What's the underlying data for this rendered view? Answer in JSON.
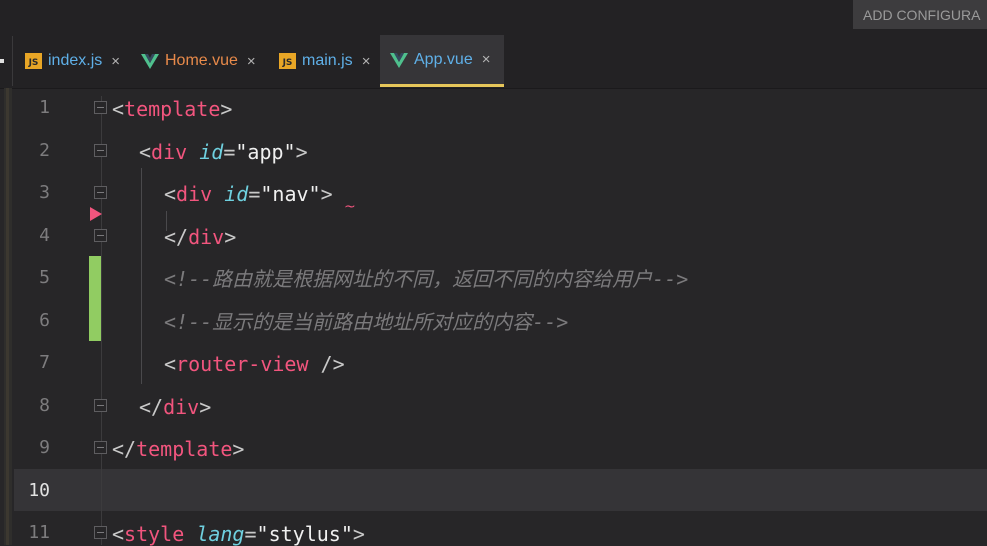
{
  "toolbar": {
    "config_label": "ADD CONFIGURA"
  },
  "tabs": [
    {
      "label": "index.js",
      "icon": "js-file-icon",
      "active": false
    },
    {
      "label": "Home.vue",
      "icon": "vue-file-icon",
      "active": false
    },
    {
      "label": "main.js",
      "icon": "js-file-icon",
      "active": false
    },
    {
      "label": "App.vue",
      "icon": "vue-file-icon",
      "active": true
    }
  ],
  "js_badge": "JS",
  "close_glyph": "×",
  "editor": {
    "current_line": 10,
    "line_numbers": [
      "1",
      "2",
      "3",
      "4",
      "5",
      "6",
      "7",
      "8",
      "9",
      "10",
      "11"
    ],
    "lines": {
      "l1": [
        "<",
        "template",
        ">"
      ],
      "l2": [
        "<",
        "div",
        "id",
        "=",
        "\"app\"",
        ">"
      ],
      "l3": [
        "<",
        "div",
        "id",
        "=",
        "\"nav\"",
        ">"
      ],
      "l4": [
        "</",
        "div",
        ">"
      ],
      "l5": "<!--路由就是根据网址的不同，返回不同的内容给用户-->",
      "l6": "<!--显示的是当前路由地址所对应的内容-->",
      "l7": [
        "<",
        "router-view",
        " />"
      ],
      "l8": [
        "</",
        "div",
        ">"
      ],
      "l9": [
        "</",
        "template",
        ">"
      ],
      "l11": [
        "<",
        "style",
        "lang",
        "=",
        "\"stylus\"",
        ">"
      ]
    },
    "squiggle": "~"
  },
  "colors": {
    "tag": "#f2557e",
    "attribute": "#6fd0df",
    "comment": "#7b7a7c",
    "active_tab_underline": "#e6c65a",
    "change_marker": "#91cc62"
  }
}
